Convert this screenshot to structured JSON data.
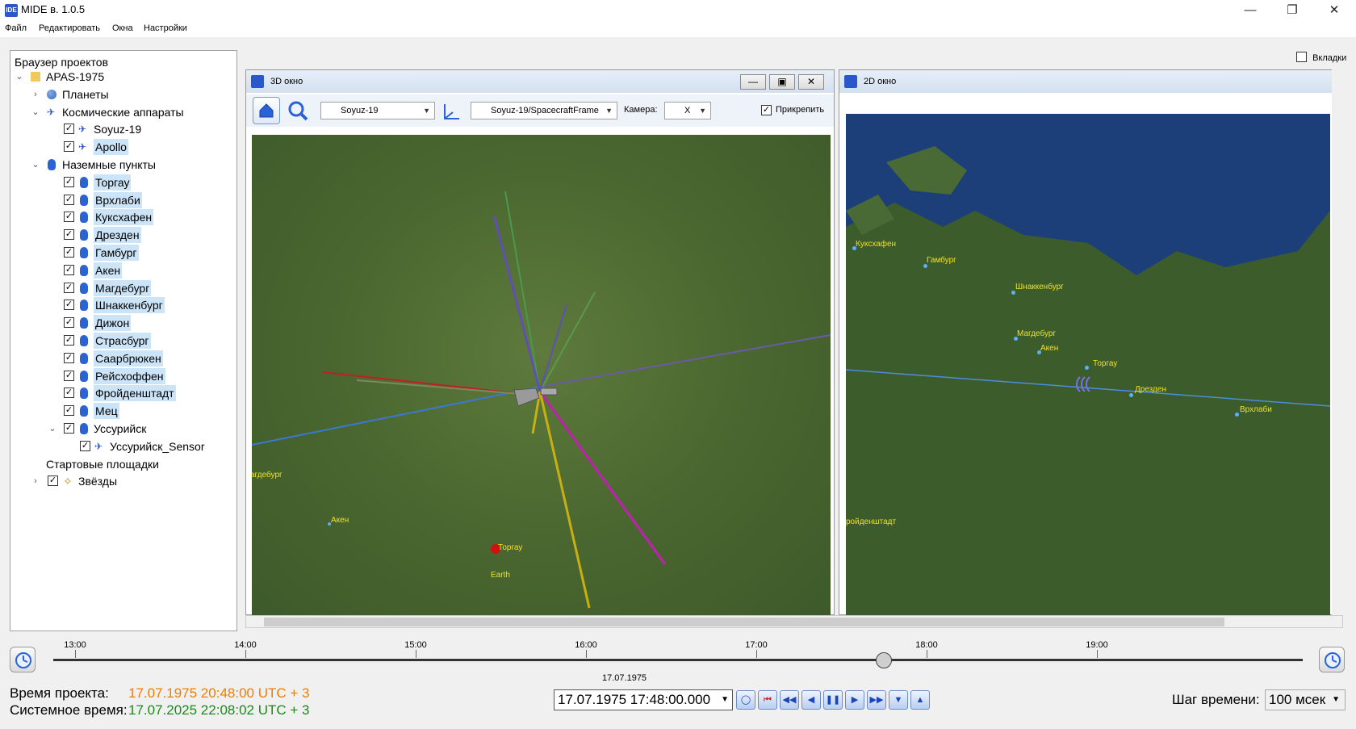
{
  "window": {
    "title": "MIDE в. 1.0.5",
    "app_icon": "IDE"
  },
  "menu": [
    "Файл",
    "Редактировать",
    "Окна",
    "Настройки"
  ],
  "tabs_checkbox": {
    "label": "Вкладки",
    "checked": false
  },
  "browser": {
    "header": "Браузер проектов",
    "project": "APAS-1975",
    "planets": "Планеты",
    "spacecraft_group": "Космические аппараты",
    "spacecraft": [
      "Soyuz-19",
      "Apollo"
    ],
    "ground_group": "Наземные пункты",
    "ground_stations": [
      "Торгау",
      "Врхлаби",
      "Куксхафен",
      "Дрезден",
      "Гамбург",
      "Акен",
      "Магдебург",
      "Шнаккенбург",
      "Дижон",
      "Страсбург",
      "Саарбрюкен",
      "Рейсхоффен",
      "Фройденштадт",
      "Мец",
      "Уссурийск"
    ],
    "sensor": "Уссурийск_Sensor",
    "launch_sites": "Стартовые площадки",
    "stars": "Звёзды"
  },
  "view3d": {
    "title": "3D окно",
    "object_combo": "Soyuz-19",
    "frame_combo": "Soyuz-19/SpacecraftFrame",
    "camera_label": "Камера:",
    "camera_combo": "X",
    "attach_label": "Прикрепить",
    "attach_checked": true,
    "labels": {
      "magdeburg": "агдебург",
      "aken": "Акен",
      "torgau": "Торгау",
      "earth": "Earth"
    }
  },
  "view2d": {
    "title": "2D окно",
    "labels": {
      "cuxhaven": "Куксхафен",
      "hamburg": "Гамбург",
      "schnackenburg": "Шнаккенбург",
      "magdeburg": "Магдебург",
      "aken": "Акен",
      "torgau": "Торгау",
      "dresden": "Дрезден",
      "vrchlabi": "Врхлаби",
      "freudenstadt": "ройденштадт"
    }
  },
  "timeline": {
    "ticks": [
      "13:00",
      "14:00",
      "15:00",
      "16:00",
      "17:00",
      "18:00",
      "19:00"
    ],
    "date_label": "17.07.1975",
    "position_fraction": 0.665
  },
  "status": {
    "project_time_label": "Время проекта:",
    "project_time_value": "17.07.1975 20:48:00 UTC + 3",
    "system_time_label": "Системное время:",
    "system_time_value": "17.07.2025 22:08:02 UTC + 3",
    "current_time": "17.07.1975 17:48:00.000",
    "step_label": "Шаг времени:",
    "step_value": "100 мсек"
  },
  "colors": {
    "project_time": "#f07d00",
    "system_time": "#1a8a1a",
    "orbit": "#3a78d8",
    "map_label": "#f0e020"
  }
}
